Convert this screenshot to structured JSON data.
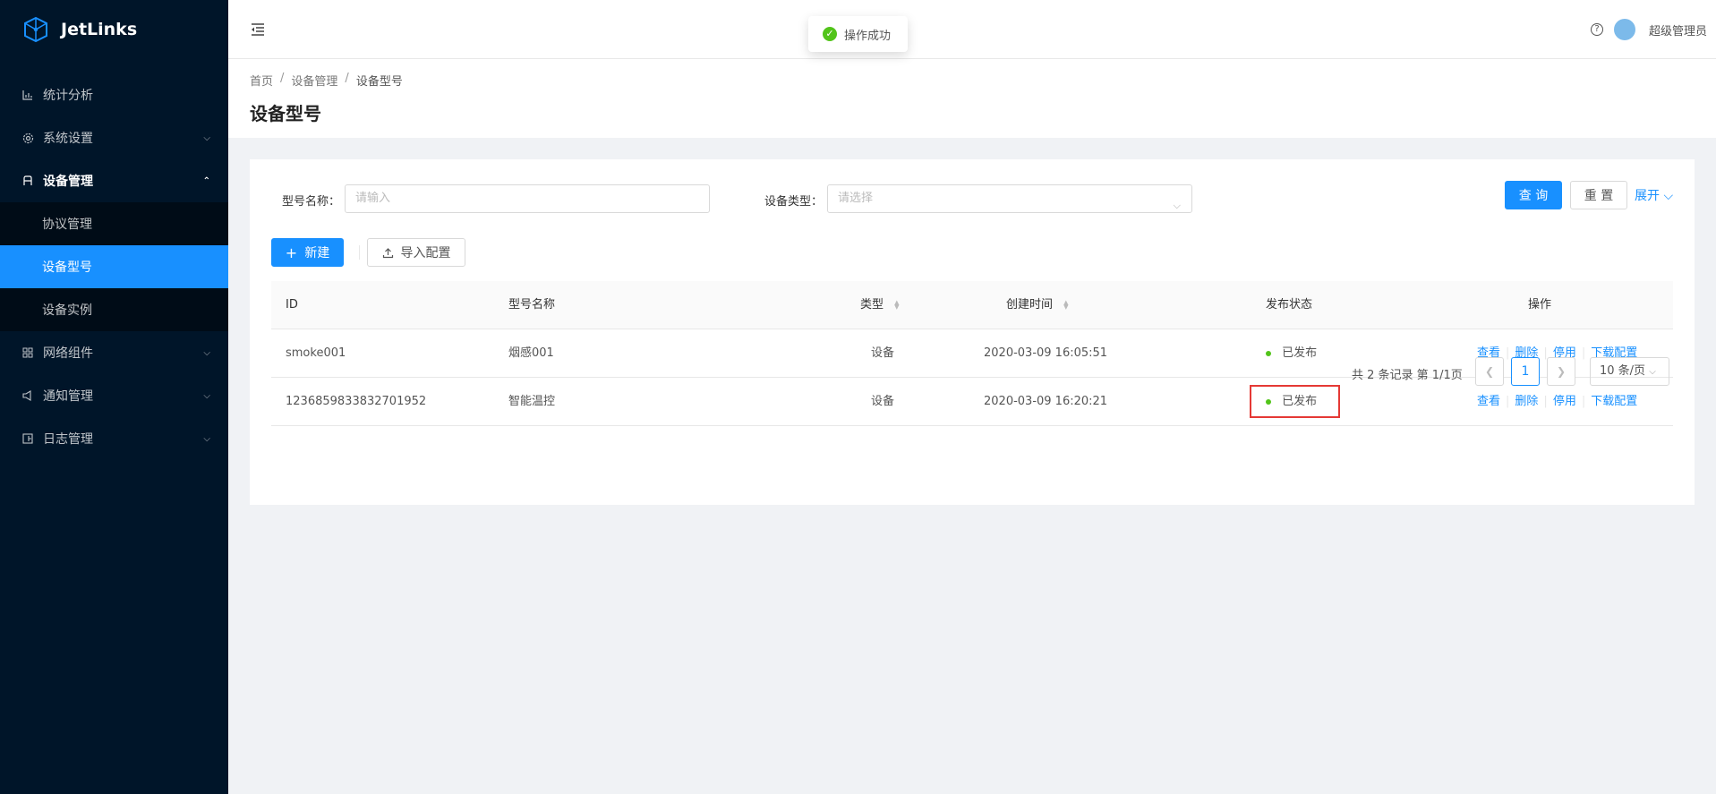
{
  "app": {
    "name": "JetLinks"
  },
  "sidebar": {
    "items": [
      {
        "label": "统计分析",
        "icon": "bar-chart-icon"
      },
      {
        "label": "系统设置",
        "icon": "gear-icon"
      },
      {
        "label": "设备管理",
        "icon": "device-icon"
      },
      {
        "label": "网络组件",
        "icon": "grid-icon"
      },
      {
        "label": "通知管理",
        "icon": "sound-icon"
      },
      {
        "label": "日志管理",
        "icon": "log-icon"
      }
    ],
    "submenu": [
      {
        "label": "协议管理"
      },
      {
        "label": "设备型号"
      },
      {
        "label": "设备实例"
      }
    ]
  },
  "header": {
    "user": "超级管理员",
    "help": "?"
  },
  "toast": {
    "text": "操作成功"
  },
  "breadcrumb": {
    "home": "首页",
    "parent": "设备管理",
    "current": "设备型号",
    "sep": "/"
  },
  "page": {
    "title": "设备型号"
  },
  "filter": {
    "name_label": "型号名称：",
    "name_placeholder": "请输入",
    "type_label": "设备类型：",
    "type_placeholder": "请选择",
    "query": "查 询",
    "reset": "重 置",
    "expand": "展开"
  },
  "toolbar": {
    "new": "新建",
    "import": "导入配置"
  },
  "table": {
    "columns": [
      "ID",
      "型号名称",
      "类型",
      "创建时间",
      "发布状态",
      "操作"
    ],
    "rows": [
      {
        "id": "smoke001",
        "name": "烟感001",
        "type": "设备",
        "created": "2020-03-09 16:05:51",
        "status": "已发布"
      },
      {
        "id": "1236859833832701952",
        "name": "智能温控",
        "type": "设备",
        "created": "2020-03-09 16:20:21",
        "status": "已发布"
      }
    ],
    "actions": [
      "查看",
      "删除",
      "停用",
      "下载配置"
    ]
  },
  "pagination": {
    "total_text": "共 2 条记录 第 1/1页",
    "current": "1",
    "page_size": "10 条/页"
  },
  "colors": {
    "primary": "#1890ff",
    "sidebar": "#001529",
    "success": "#52c41a",
    "highlight": "#e53935"
  }
}
